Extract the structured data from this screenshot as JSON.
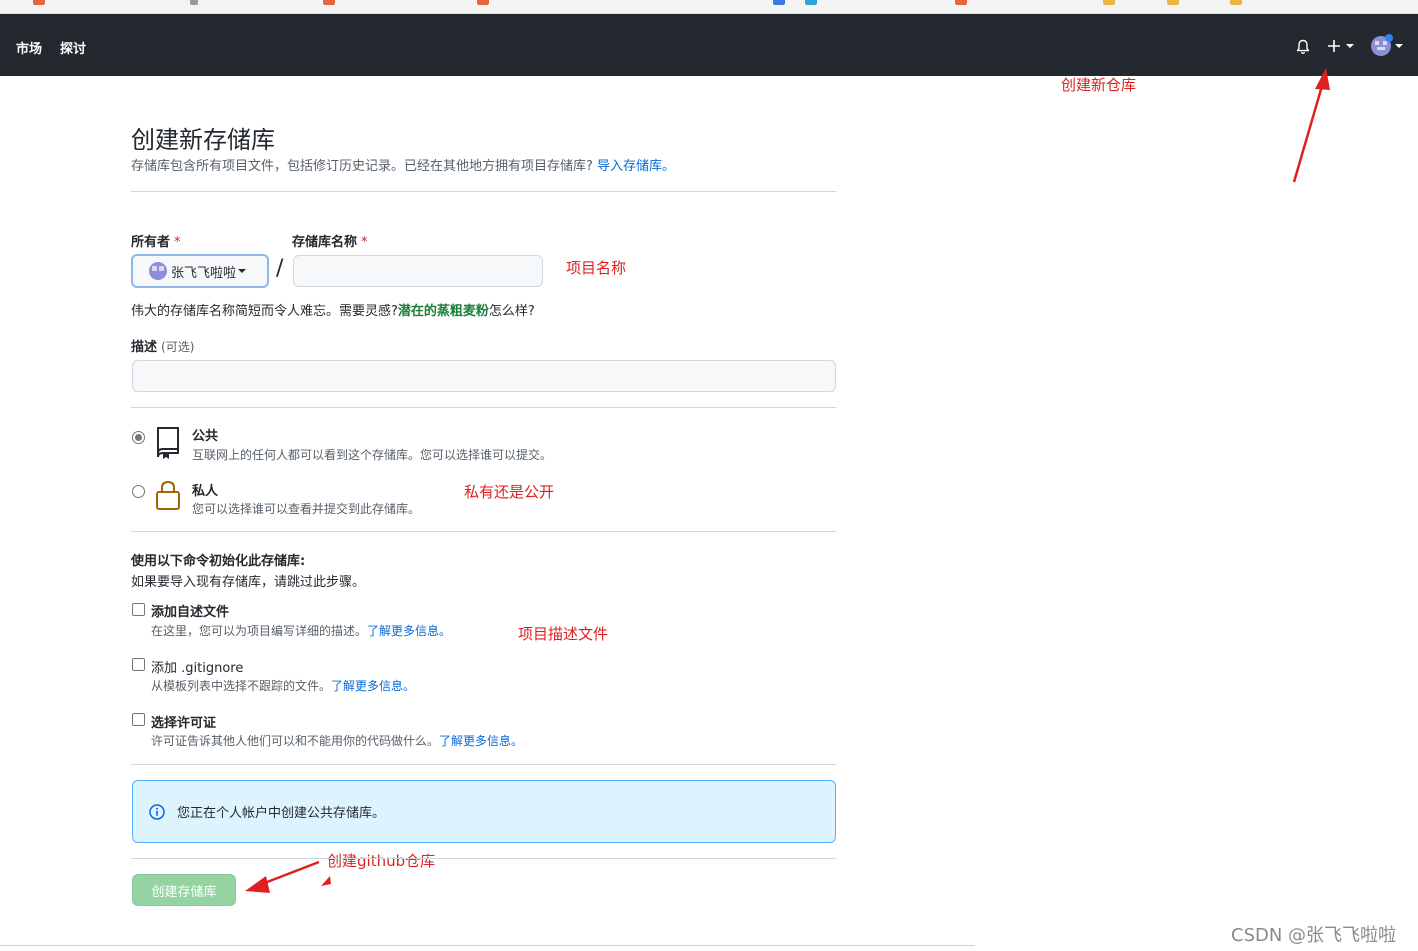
{
  "colors": {
    "header_bg": "#24292f",
    "annotation_red": "#e02020",
    "link_blue": "#0969da",
    "suggest_green": "#1a7f37",
    "create_button_disabled": "#94d3a2",
    "notice_bg": "#ddf4ff"
  },
  "header": {
    "nav": [
      "市场",
      "探讨"
    ],
    "icons": [
      "bell-icon",
      "plus-icon",
      "avatar"
    ]
  },
  "annotations": {
    "create_repo": "创建新仓库",
    "project_name": "项目名称",
    "private_or_public": "私有还是公开",
    "readme_file": "项目描述文件",
    "create_github_repo": "创建github仓库"
  },
  "page": {
    "title": "创建新存储库",
    "subtitle": "存储库包含所有项目文件，包括修订历史记录。已经在其他地方拥有项目存储库?",
    "import_link": "导入存储库。"
  },
  "form": {
    "owner_label": "所有者",
    "required_mark": "*",
    "owner_value": "张飞飞啦啦",
    "repo_name_label": "存储库名称",
    "repo_name_value": "",
    "slash": "/",
    "hint_prefix": "伟大的存储库名称简短而令人难忘。需要灵感?",
    "hint_suggestion": "潜在的蒸粗麦粉",
    "hint_suffix": "怎么样?",
    "description_label": "描述",
    "description_optional": "(可选)",
    "description_value": ""
  },
  "visibility": {
    "selected": "public",
    "public_title": "公共",
    "public_desc": "互联网上的任何人都可以看到这个存储库。您可以选择谁可以提交。",
    "private_title": "私人",
    "private_desc": "您可以选择谁可以查看并提交到此存储库。"
  },
  "init": {
    "heading": "使用以下命令初始化此存储库:",
    "subheading": "如果要导入现有存储库，请跳过此步骤。",
    "readme_title": "添加自述文件",
    "readme_desc": "在这里，您可以为项目编写详细的描述。",
    "gitignore_title": "添加 .gitignore",
    "gitignore_desc": "从模板列表中选择不跟踪的文件。",
    "license_title": "选择许可证",
    "license_desc": "许可证告诉其他人他们可以和不能用你的代码做什么。",
    "learn_more": "了解更多信息。"
  },
  "notice": {
    "text": "您正在个人帐户中创建公共存储库。"
  },
  "submit": {
    "label": "创建存储库"
  },
  "watermark": "CSDN @张飞飞啦啦"
}
